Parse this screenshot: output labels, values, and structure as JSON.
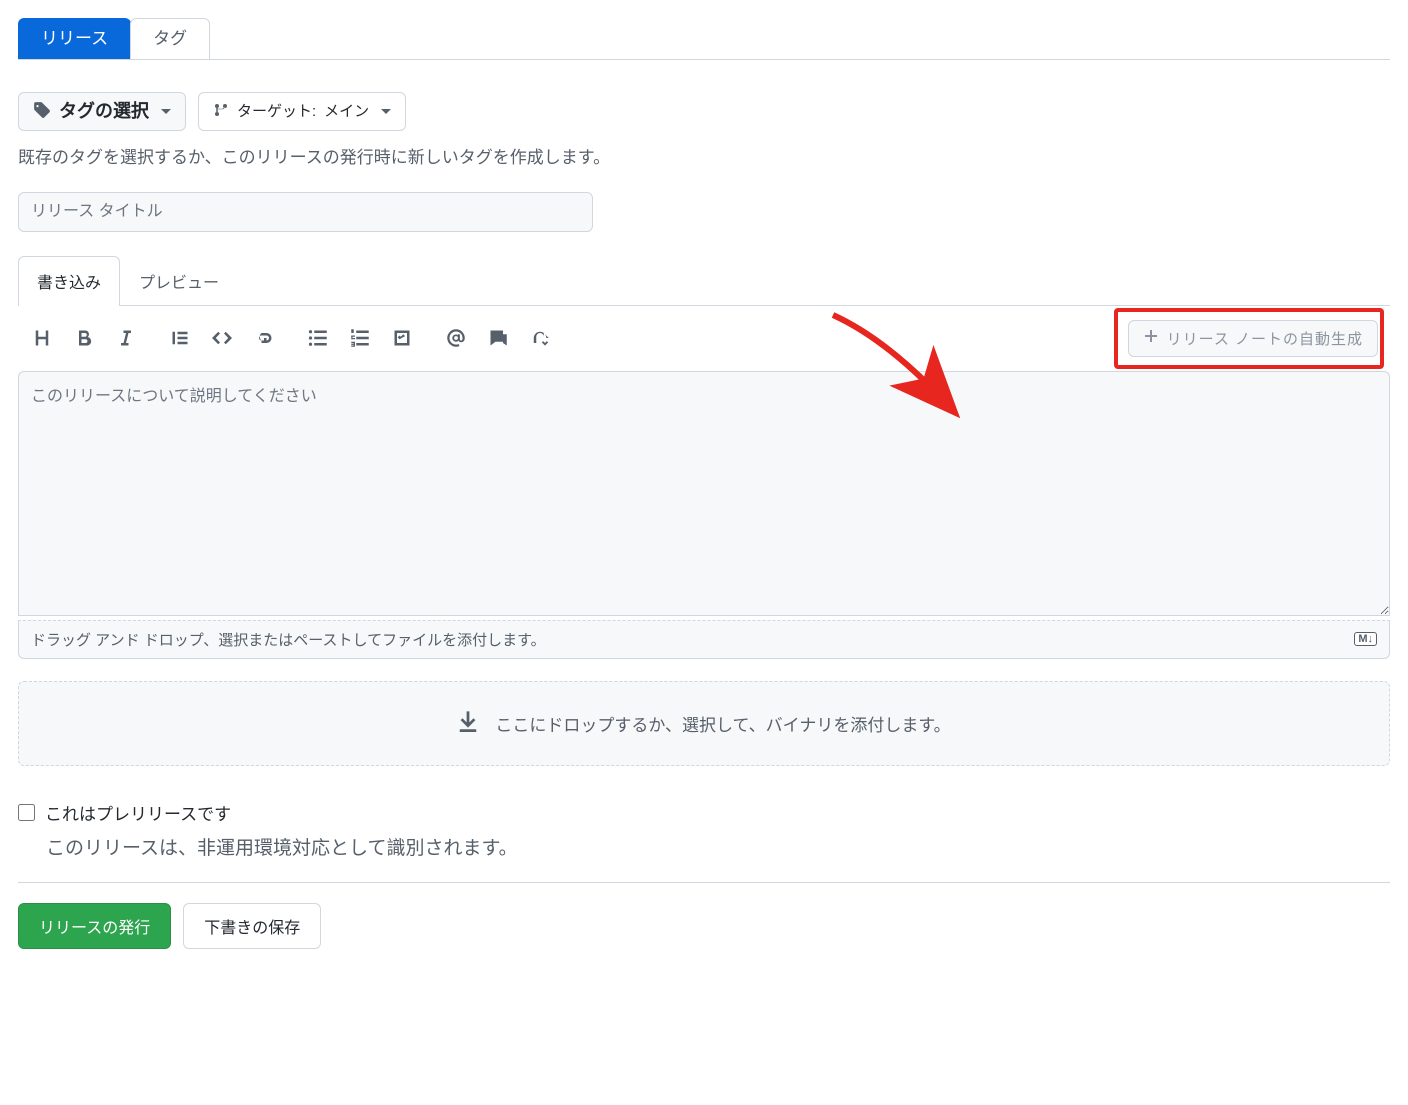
{
  "nav": {
    "release": "リリース",
    "tag": "タグ"
  },
  "tag_select": {
    "label": "タグの選択"
  },
  "target": {
    "prefix": "ターゲット:",
    "value": "メイン"
  },
  "tag_help": "既存のタグを選択するか、このリリースの発行時に新しいタグを作成します。",
  "title_placeholder": "リリース タイトル",
  "editor_tabs": {
    "write": "書き込み",
    "preview": "プレビュー"
  },
  "auto_gen_label": "リリース ノートの自動生成",
  "desc_placeholder": "このリリースについて説明してください",
  "attach_hint": "ドラッグ アンド ドロップ、選択またはペーストしてファイルを添付します。",
  "dropzone_text": "ここにドロップするか、選択して、バイナリを添付します。",
  "prerelease": {
    "label": "これはプレリリースです",
    "desc": "このリリースは、非運用環境対応として識別されます。"
  },
  "actions": {
    "publish": "リリースの発行",
    "draft": "下書きの保存"
  },
  "md_badge": "M↓"
}
